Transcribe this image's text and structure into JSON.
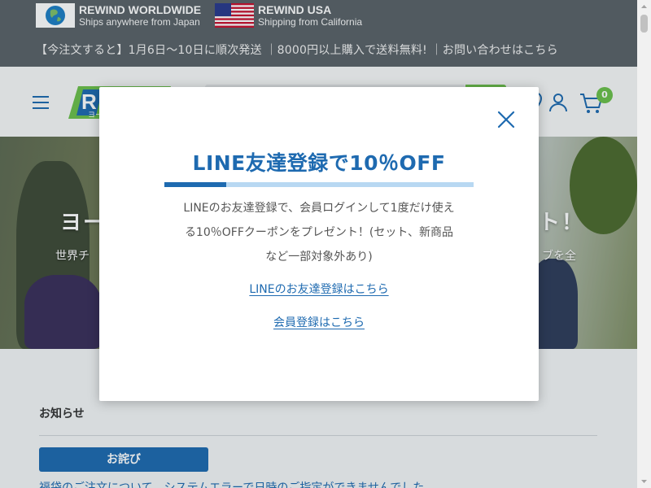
{
  "topbar": {
    "worldwide": {
      "title": "REWIND WORLDWIDE",
      "subtitle": "Ships anywhere from Japan",
      "icon": "globe-icon"
    },
    "usa": {
      "title": "REWIND USA",
      "subtitle": "Shipping from California",
      "icon": "us-flag-icon"
    },
    "announcement": "【今注文すると】1月6日〜10日に順次発送 ｜8000円以上購入で送料無料! ｜お問い合わせはこちら"
  },
  "header": {
    "cart_count": "0",
    "logo_text": "R",
    "logo_sub": "ヨー"
  },
  "hero": {
    "title_left": "ヨー",
    "title_right": "ト！",
    "sub_left": "世界チ",
    "sub_right": "ブを全"
  },
  "news": {
    "title": "お知らせ",
    "badge": "お詫び",
    "line": "福袋のご注文について　システムエラーで日時のご指定ができませんでした"
  },
  "modal": {
    "title": "LINE友達登録で10％OFF",
    "description_lines": [
      "LINEのお友達登録で、会員ログインして1度だけ使え",
      "る10％OFFクーポンをプレゼント！(セット、新商品",
      "など一部対象外あり)"
    ],
    "line_link": "LINEのお友達登録はこちら",
    "member_link": "会員登録はこちら"
  },
  "colors": {
    "brand_blue": "#1e6ab0",
    "brand_green": "#6cc04a",
    "topbar_bg": "#5b6268"
  }
}
